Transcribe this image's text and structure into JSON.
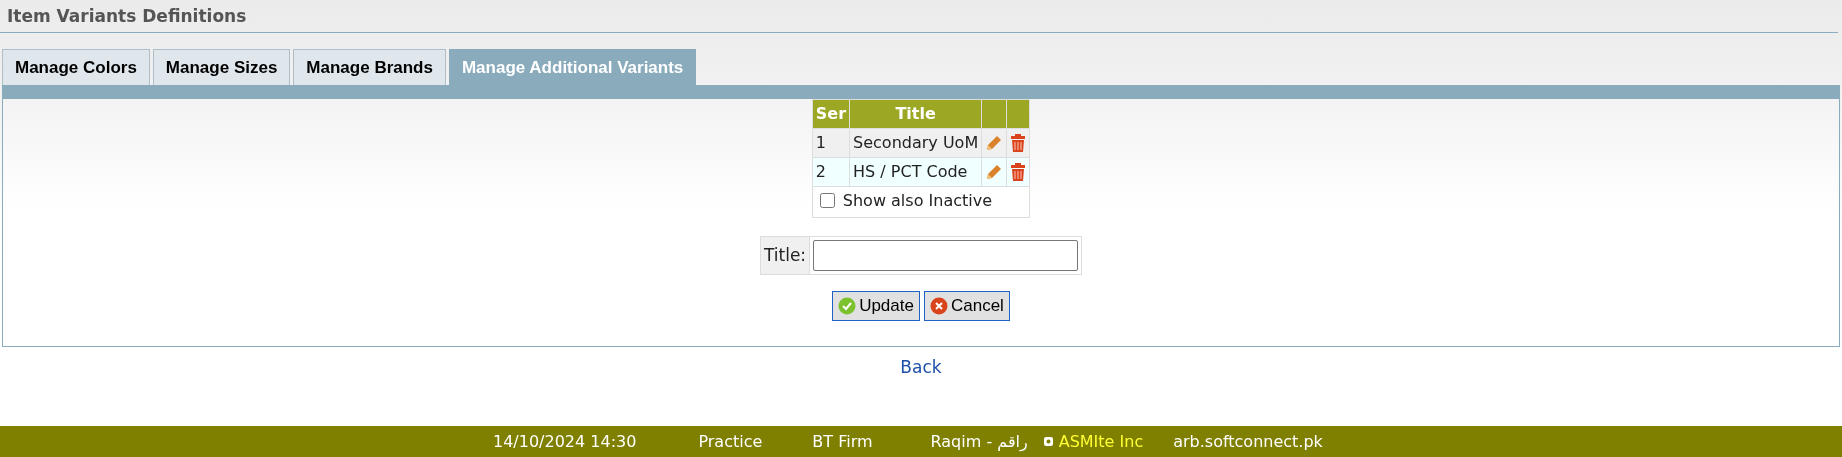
{
  "page_title": "Item Variants Definitions",
  "tabs": [
    {
      "label": "Manage Colors",
      "selected": false
    },
    {
      "label": "Manage Sizes",
      "selected": false
    },
    {
      "label": "Manage Brands",
      "selected": false
    },
    {
      "label": "Manage Additional Variants",
      "selected": true
    }
  ],
  "table": {
    "columns": [
      "Ser",
      "Title"
    ],
    "rows": [
      {
        "ser": "1",
        "title": "Secondary UoM"
      },
      {
        "ser": "2",
        "title": "HS / PCT Code"
      }
    ],
    "show_inactive": {
      "label": "Show also Inactive",
      "checked": false
    }
  },
  "form": {
    "label": "Title:"
  },
  "buttons": [
    {
      "label": "Update",
      "kind": "ok"
    },
    {
      "label": "Cancel",
      "kind": "cancel"
    }
  ],
  "back_link": "Back",
  "status_bar": [
    {
      "text": "14/10/2024 14:30",
      "kind": "plain"
    },
    {
      "text": "Practice",
      "kind": "plain"
    },
    {
      "text": "BT Firm",
      "kind": "plain"
    },
    {
      "text": "Raqim - راقم",
      "kind": "plain"
    },
    {
      "text": "ASMIte Inc",
      "kind": "brand"
    },
    {
      "text": "arb.softconnect.pk",
      "kind": "plain"
    }
  ]
}
